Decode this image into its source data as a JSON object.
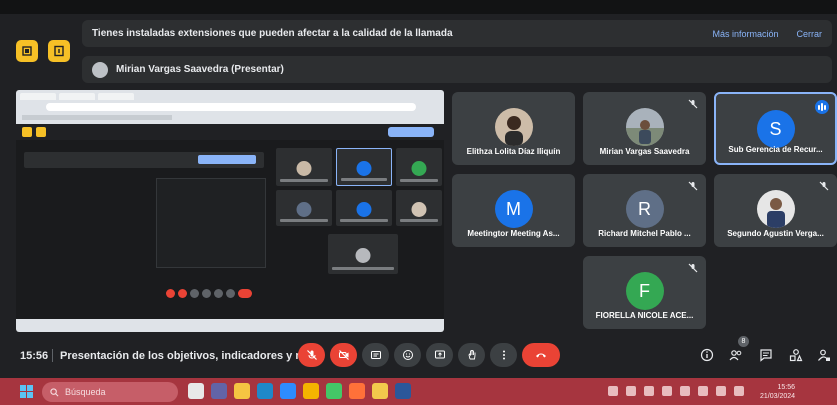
{
  "banner": {
    "message": "Tienes instaladas extensiones que pueden afectar a la calidad de la llamada",
    "more_info": "Más información",
    "close": "Cerrar"
  },
  "presenter": {
    "label": "Mirian Vargas Saavedra (Presentar)"
  },
  "participants": [
    {
      "name": "Elithza Lolita Díaz Iliquín",
      "avatar_type": "photo",
      "muted": false
    },
    {
      "name": "Mirian Vargas Saavedra",
      "avatar_type": "photo",
      "muted": true
    },
    {
      "name": "Sub Gerencia de Recur...",
      "avatar_type": "letter",
      "letter": "S",
      "color": "#1a73e8",
      "speaking": true,
      "active": true
    },
    {
      "name": "Meetingtor Meeting As...",
      "avatar_type": "letter",
      "letter": "M",
      "color": "#1a73e8",
      "muted": false
    },
    {
      "name": "Richard Mitchel Pablo ...",
      "avatar_type": "letter",
      "letter": "R",
      "color": "#5f6f87",
      "muted": true
    },
    {
      "name": "Segundo Agustin Verga...",
      "avatar_type": "photo",
      "muted": true
    },
    {
      "name": "FIORELLA NICOLE ACE...",
      "avatar_type": "letter",
      "letter": "F",
      "color": "#34a853",
      "muted": true
    }
  ],
  "bottom_bar": {
    "time": "15:56",
    "meeting_title": "Presentación de los objetivos, indicadores y m...",
    "participant_count": "8"
  },
  "taskbar": {
    "search_placeholder": "Búsqueda",
    "clock_time": "15:56",
    "clock_date": "21/03/2024"
  },
  "colors": {
    "accent_blue": "#8ab4f8",
    "meet_red": "#ea4335",
    "presenting_yellow": "#f6c026",
    "taskbar": "#a6353f"
  }
}
